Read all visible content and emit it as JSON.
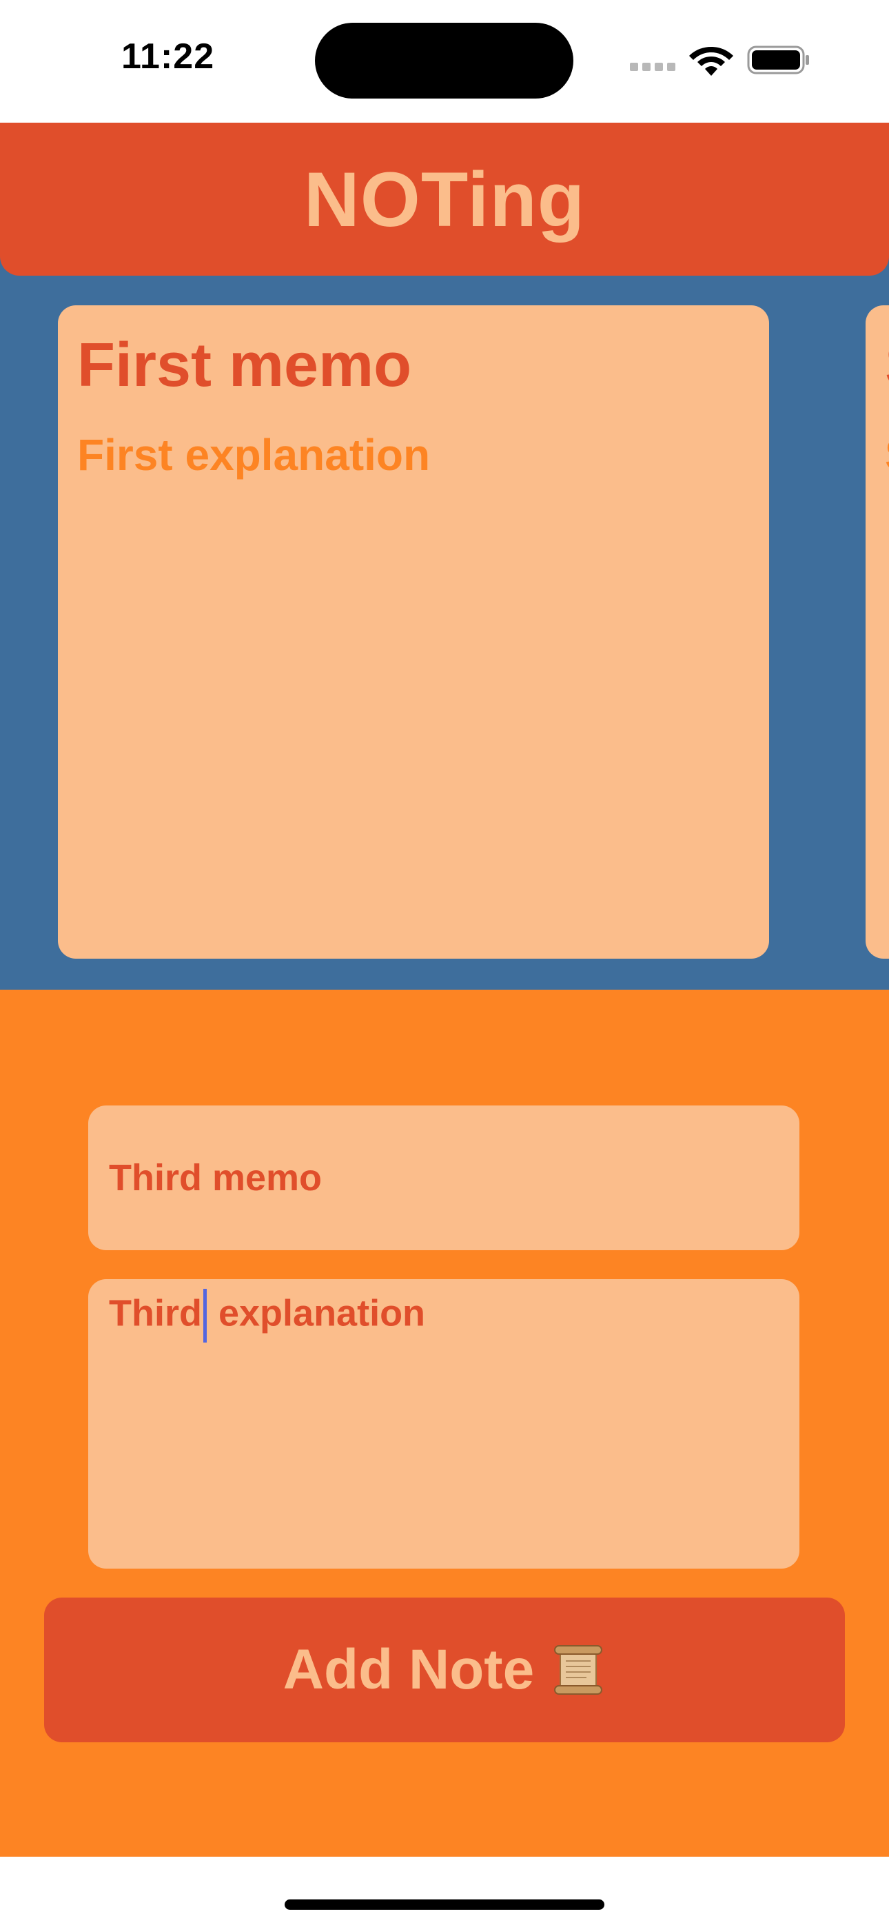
{
  "status_bar": {
    "time": "11:22",
    "icons": [
      "signal-icon",
      "wifi-icon",
      "battery-icon"
    ]
  },
  "header": {
    "title": "NOTing"
  },
  "memos": [
    {
      "title": "First memo",
      "description": "First explanation"
    },
    {
      "title": "S",
      "description": "S"
    }
  ],
  "form": {
    "title_value": "Third memo",
    "description_value_before_caret": "Third",
    "description_value_after_caret": " explanation",
    "button_label": "Add Note",
    "button_icon": "scroll-icon"
  },
  "colors": {
    "header": "#e04e2b",
    "title_text": "#fbbd8b",
    "memo_background": "#3e6e9c",
    "card": "#fbbd8b",
    "memo_title": "#e04e2b",
    "memo_description": "#fd8423",
    "form_background": "#fd8423",
    "button": "#e04e2b",
    "caret": "#5466e0"
  }
}
